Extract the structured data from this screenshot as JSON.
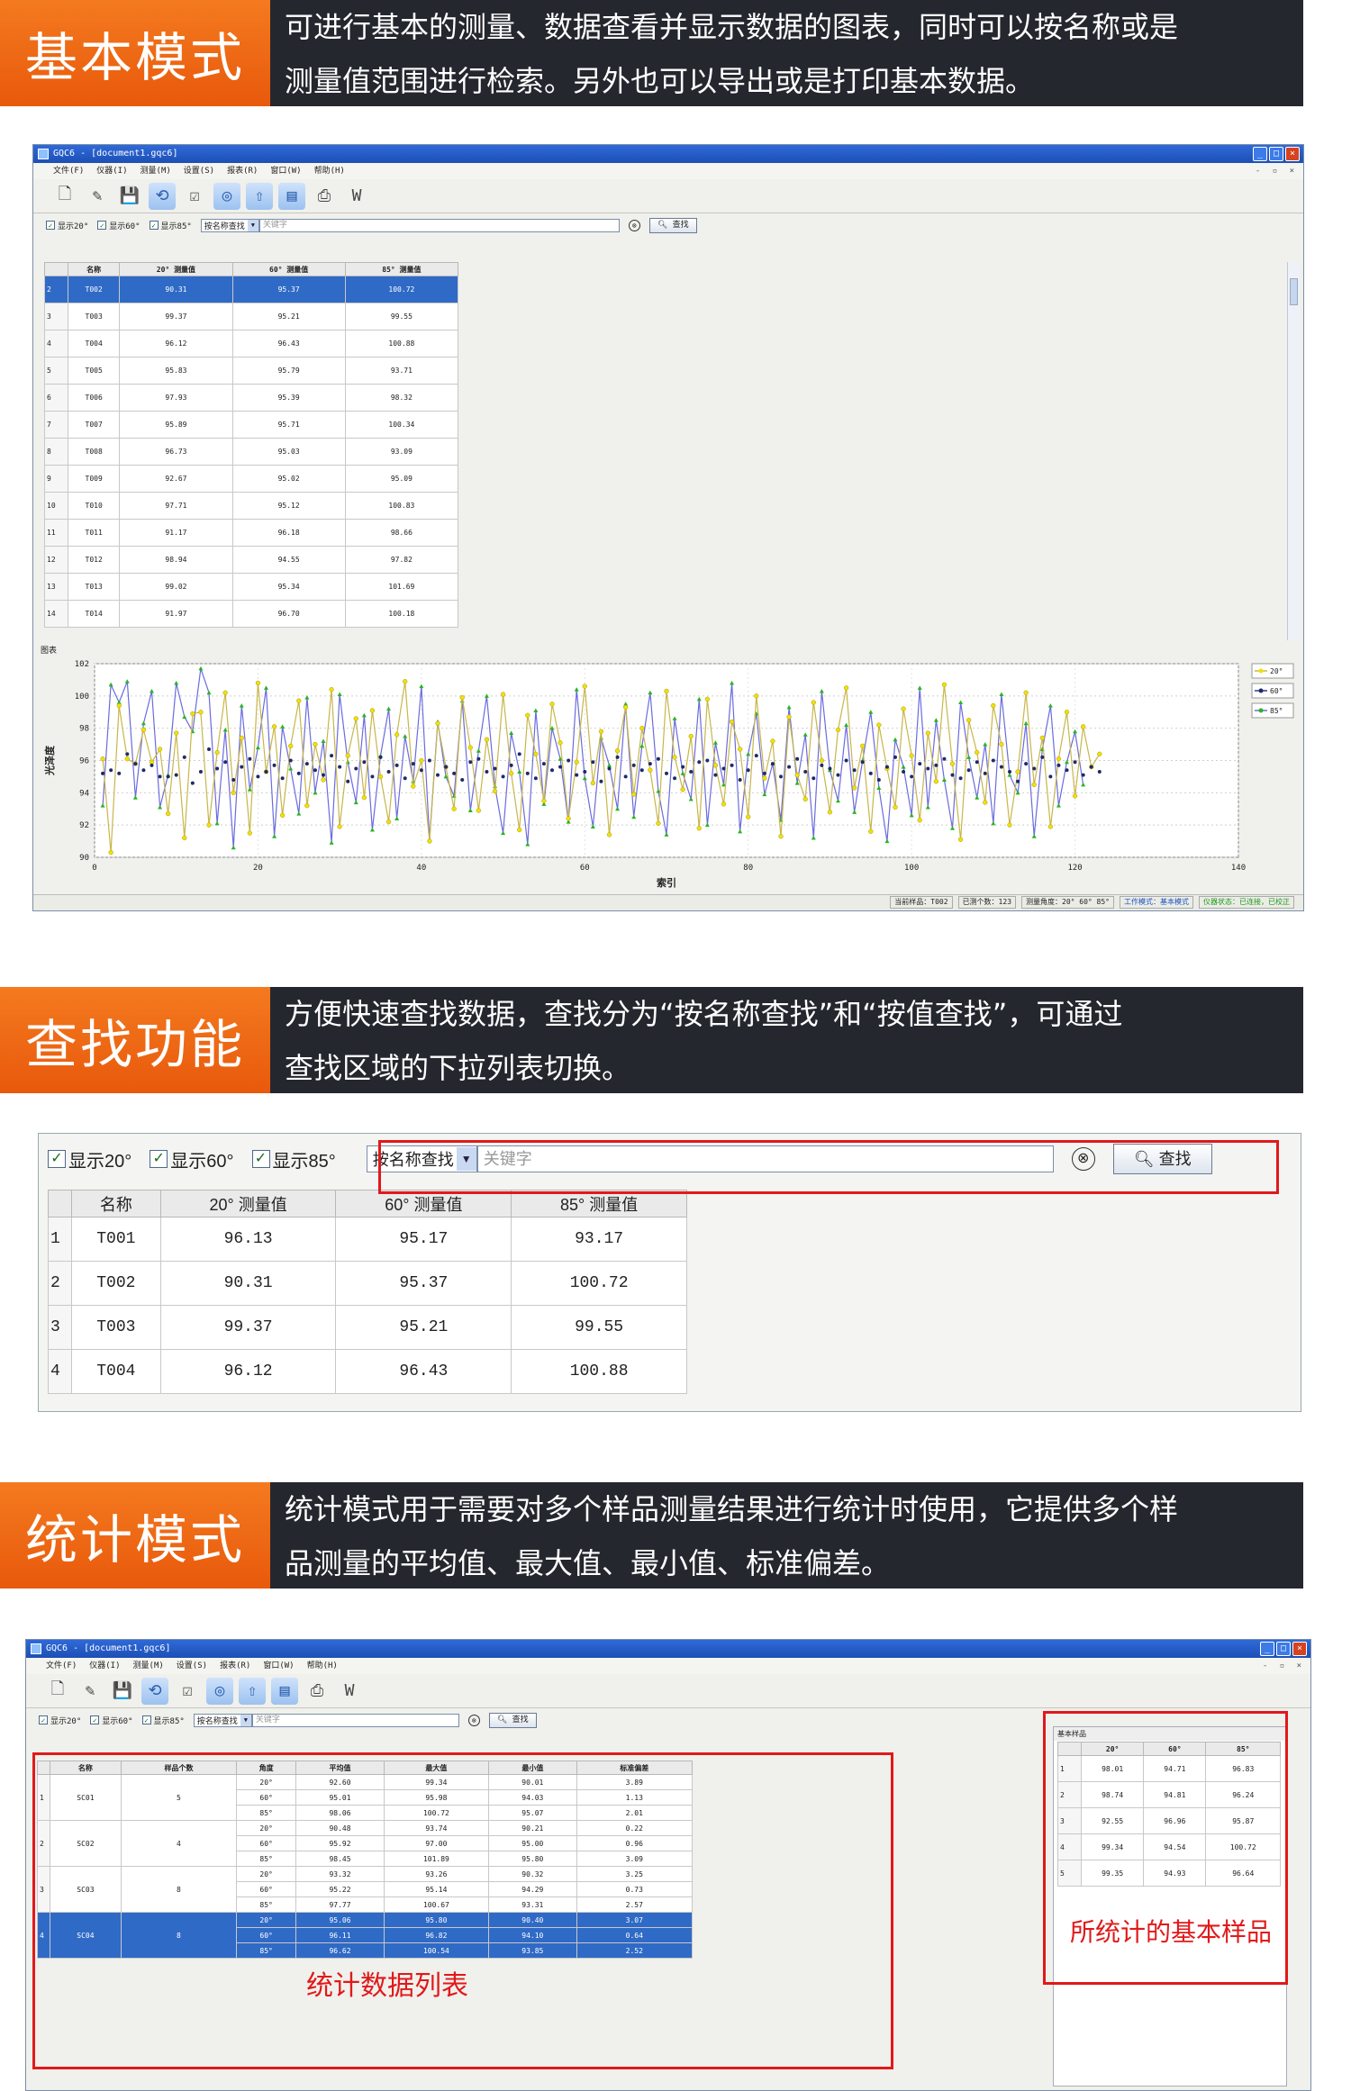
{
  "sections": [
    {
      "tag": "基本模式",
      "line1": "可进行基本的测量、数据查看并显示数据的图表，同时可以按名称或是",
      "line2": "测量值范围进行检索。另外也可以导出或是打印基本数据。"
    },
    {
      "tag": "查找功能",
      "line1": "方便快速查找数据，查找分为“按名称查找”和“按值查找”，可通过",
      "line2": "查找区域的下拉列表切换。"
    },
    {
      "tag": "统计模式",
      "line1": "统计模式用于需要对多个样品测量结果进行统计时使用，它提供多个样",
      "line2": "品测量的平均值、最大值、最小值、标准偏差。"
    }
  ],
  "window": {
    "title": "GQC6 - [document1.gqc6]",
    "menu": [
      "文件(F)",
      "仪器(I)",
      "测量(M)",
      "设置(S)",
      "报表(R)",
      "窗口(W)",
      "帮助(H)"
    ]
  },
  "filter": {
    "show20": "显示20°",
    "show60": "显示60°",
    "show85": "显示85°",
    "mode": "按名称查找",
    "placeholder": "关键字",
    "search": "查找",
    "clear": "⊗"
  },
  "grid1": {
    "headers": [
      "",
      "名称",
      "20° 测量值",
      "60° 测量值",
      "85° 测量值"
    ],
    "rows": [
      [
        "2",
        "T002",
        "90.31",
        "95.37",
        "100.72"
      ],
      [
        "3",
        "T003",
        "99.37",
        "95.21",
        "99.55"
      ],
      [
        "4",
        "T004",
        "96.12",
        "96.43",
        "100.88"
      ],
      [
        "5",
        "T005",
        "95.83",
        "95.79",
        "93.71"
      ],
      [
        "6",
        "T006",
        "97.93",
        "95.39",
        "98.32"
      ],
      [
        "7",
        "T007",
        "95.89",
        "95.71",
        "100.34"
      ],
      [
        "8",
        "T008",
        "96.73",
        "95.03",
        "93.09"
      ],
      [
        "9",
        "T009",
        "92.67",
        "95.02",
        "95.09"
      ],
      [
        "10",
        "T010",
        "97.71",
        "95.12",
        "100.83"
      ],
      [
        "11",
        "T011",
        "91.17",
        "96.18",
        "98.66"
      ],
      [
        "12",
        "T012",
        "98.94",
        "94.55",
        "97.82"
      ],
      [
        "13",
        "T013",
        "99.02",
        "95.34",
        "101.69"
      ],
      [
        "14",
        "T014",
        "91.97",
        "96.70",
        "100.18"
      ]
    ]
  },
  "chart_panel_title": "图表",
  "chart_data": {
    "type": "line",
    "xlabel": "索引",
    "ylabel": "光泽度",
    "xlim": [
      0,
      140
    ],
    "ylim": [
      90,
      102
    ],
    "xticks": [
      0,
      20,
      40,
      60,
      80,
      100,
      120,
      140
    ],
    "yticks": [
      90,
      92,
      94,
      96,
      98,
      100,
      102
    ],
    "grid": true,
    "legend": "right",
    "series": [
      {
        "name": "20°",
        "color": "#c8b64a",
        "marker": "#f2e000",
        "values": [
          96.1,
          90.3,
          99.4,
          96.1,
          95.8,
          97.9,
          95.9,
          96.7,
          92.7,
          97.7,
          91.2,
          98.9,
          99.0,
          92.0,
          96.5,
          100.2,
          94.0,
          97.4,
          91.5,
          100.8,
          95.3,
          98.1,
          92.6,
          96.9,
          99.7,
          93.2,
          97.0,
          94.8,
          100.4,
          91.9,
          96.3,
          98.6,
          93.7,
          99.1,
          95.0,
          92.2,
          97.6,
          100.9,
          94.4,
          96.0,
          91.0,
          98.3,
          95.6,
          93.0,
          99.9,
          96.8,
          92.9,
          97.3,
          94.1,
          100.1,
          95.2,
          91.7,
          98.8,
          96.4,
          93.5,
          99.5,
          97.1,
          92.4,
          95.9,
          100.6,
          94.6,
          97.8,
          91.4,
          96.6,
          99.3,
          93.9,
          98.0,
          95.4,
          92.1,
          100.3,
          96.2,
          94.2,
          97.5,
          91.8,
          99.8,
          95.7,
          93.3,
          98.4,
          96.7,
          92.5,
          100.0,
          94.9,
          97.2,
          91.3,
          98.7,
          95.1,
          93.6,
          99.6,
          96.0,
          92.8,
          97.9,
          100.5,
          94.3,
          96.9,
          91.6,
          98.2,
          95.5,
          93.1,
          99.2,
          96.3,
          92.3,
          97.7,
          94.7,
          100.7,
          95.8,
          91.1,
          98.5,
          96.5,
          93.4,
          99.4,
          97.0,
          92.0,
          95.3,
          100.2,
          94.5,
          97.4,
          91.9,
          96.1,
          99.0,
          93.8,
          98.1,
          95.6,
          96.4
        ]
      },
      {
        "name": "60°",
        "color": "#2f3a8a",
        "marker": "#1f2a6a",
        "values": [
          95.2,
          95.4,
          95.2,
          96.4,
          95.8,
          95.4,
          95.7,
          95.0,
          95.0,
          95.1,
          96.2,
          94.6,
          95.3,
          96.7,
          95.5,
          95.9,
          94.8,
          95.6,
          96.1,
          95.0,
          95.3,
          95.7,
          94.9,
          96.0,
          95.2,
          95.8,
          95.4,
          95.1,
          96.3,
          95.6,
          94.7,
          95.5,
          95.9,
          95.0,
          96.2,
          95.3,
          95.7,
          94.9,
          95.8,
          95.4,
          96.0,
          95.1,
          95.6,
          95.2,
          94.8,
          95.9,
          96.1,
          95.3,
          95.5,
          95.0,
          95.7,
          96.4,
          95.2,
          94.9,
          95.8,
          95.4,
          95.6,
          96.0,
          95.1,
          95.3,
          95.9,
          94.7,
          95.5,
          96.2,
          95.0,
          95.7,
          95.4,
          95.8,
          96.1,
          95.2,
          94.9,
          95.6,
          95.3,
          95.9,
          96.0,
          95.1,
          95.5,
          95.7,
          94.8,
          95.4,
          96.3,
          95.2,
          95.8,
          95.0,
          95.6,
          96.1,
          95.3,
          94.9,
          95.7,
          95.5,
          95.1,
          96.0,
          95.4,
          95.9,
          95.2,
          94.8,
          95.6,
          96.2,
          95.3,
          95.0,
          95.8,
          95.5,
          95.7,
          96.1,
          95.1,
          94.9,
          95.4,
          95.9,
          95.2,
          96.0,
          95.6,
          95.3,
          94.7,
          95.8,
          95.5,
          96.2,
          95.0,
          95.7,
          95.4,
          95.9,
          95.1,
          95.6,
          95.3
        ]
      },
      {
        "name": "85°",
        "color": "#6b6bde",
        "marker": "#27b524",
        "values": [
          93.2,
          100.7,
          99.6,
          100.9,
          93.7,
          98.3,
          100.3,
          93.1,
          95.1,
          100.8,
          98.7,
          97.8,
          101.7,
          100.2,
          92.1,
          97.9,
          90.6,
          99.4,
          94.2,
          96.8,
          100.5,
          91.3,
          98.1,
          95.5,
          92.7,
          99.9,
          94.0,
          97.2,
          90.9,
          100.1,
          95.9,
          93.4,
          98.8,
          91.7,
          96.3,
          99.2,
          92.4,
          97.5,
          94.7,
          100.6,
          91.1,
          98.4,
          95.0,
          93.8,
          99.7,
          92.9,
          96.6,
          100.0,
          94.4,
          91.5,
          97.7,
          95.3,
          90.8,
          99.1,
          93.3,
          98.0,
          96.1,
          92.2,
          100.4,
          94.9,
          91.9,
          97.4,
          95.7,
          93.0,
          99.5,
          92.5,
          96.9,
          100.2,
          94.1,
          91.4,
          98.6,
          95.2,
          93.6,
          99.8,
          92.0,
          97.1,
          94.5,
          100.8,
          91.6,
          96.4,
          98.9,
          93.9,
          95.8,
          92.3,
          99.3,
          94.6,
          97.6,
          91.2,
          100.3,
          95.4,
          93.5,
          98.2,
          92.8,
          96.0,
          99.0,
          94.3,
          91.0,
          97.3,
          95.6,
          92.6,
          100.5,
          93.1,
          98.5,
          94.8,
          91.8,
          99.6,
          96.2,
          93.7,
          97.0,
          92.1,
          100.1,
          95.1,
          94.0,
          98.3,
          91.3,
          96.7,
          99.4,
          93.2,
          95.9,
          97.8,
          94.5
        ]
      }
    ]
  },
  "legend": [
    "20°",
    "60°",
    "85°"
  ],
  "status1": {
    "sample": "当前样品：T002",
    "count": "已测个数：123",
    "angle": "测量角度：20° 60° 85°",
    "mode": "工作模式：基本模式",
    "device": "仪器状态：已连接，已校正"
  },
  "grid2": {
    "headers": [
      "",
      "名称",
      "20° 测量值",
      "60° 测量值",
      "85° 测量值"
    ],
    "rows": [
      [
        "1",
        "T001",
        "96.13",
        "95.17",
        "93.17"
      ],
      [
        "2",
        "T002",
        "90.31",
        "95.37",
        "100.72"
      ],
      [
        "3",
        "T003",
        "99.37",
        "95.21",
        "99.55"
      ],
      [
        "4",
        "T004",
        "96.12",
        "96.43",
        "100.88"
      ]
    ]
  },
  "statgrid": {
    "headers": [
      "",
      "名称",
      "样品个数",
      "角度",
      "平均值",
      "最大值",
      "最小值",
      "标准偏差"
    ],
    "groups": [
      {
        "rn": "1",
        "name": "SC01",
        "count": "5",
        "angles": [
          "20°",
          "60°",
          "85°"
        ],
        "avg": [
          "92.60",
          "95.01",
          "98.06"
        ],
        "max": [
          "99.34",
          "95.98",
          "100.72"
        ],
        "min": [
          "90.01",
          "94.03",
          "95.07"
        ],
        "sd": [
          "3.89",
          "1.13",
          "2.01"
        ]
      },
      {
        "rn": "2",
        "name": "SC02",
        "count": "4",
        "angles": [
          "20°",
          "60°",
          "85°"
        ],
        "avg": [
          "90.48",
          "95.92",
          "98.45"
        ],
        "max": [
          "93.74",
          "97.00",
          "101.89"
        ],
        "min": [
          "90.21",
          "95.00",
          "95.80"
        ],
        "sd": [
          "0.22",
          "0.96",
          "3.09"
        ]
      },
      {
        "rn": "3",
        "name": "SC03",
        "count": "8",
        "angles": [
          "20°",
          "60°",
          "85°"
        ],
        "avg": [
          "93.32",
          "95.22",
          "97.77"
        ],
        "max": [
          "93.26",
          "95.14",
          "100.67"
        ],
        "min": [
          "90.32",
          "94.29",
          "93.31"
        ],
        "sd": [
          "3.25",
          "0.73",
          "2.57"
        ]
      },
      {
        "rn": "4",
        "name": "SC04",
        "count": "8",
        "angles": [
          "20°",
          "60°",
          "85°"
        ],
        "avg": [
          "95.06",
          "96.11",
          "96.62"
        ],
        "max": [
          "95.80",
          "96.82",
          "100.54"
        ],
        "min": [
          "90.40",
          "94.10",
          "93.85"
        ],
        "sd": [
          "3.07",
          "0.64",
          "2.52"
        ]
      }
    ]
  },
  "basegrid": {
    "title": "基本样品",
    "headers": [
      "",
      "20°",
      "60°",
      "85°"
    ],
    "rows": [
      [
        "1",
        "98.01",
        "94.71",
        "96.83"
      ],
      [
        "2",
        "98.74",
        "94.81",
        "96.24"
      ],
      [
        "3",
        "92.55",
        "96.96",
        "95.87"
      ],
      [
        "4",
        "99.34",
        "94.54",
        "100.72"
      ],
      [
        "5",
        "99.35",
        "94.93",
        "96.64"
      ]
    ]
  },
  "annotations": {
    "stat_list": "统计数据列表",
    "base_samples": "所统计的基本样品"
  }
}
